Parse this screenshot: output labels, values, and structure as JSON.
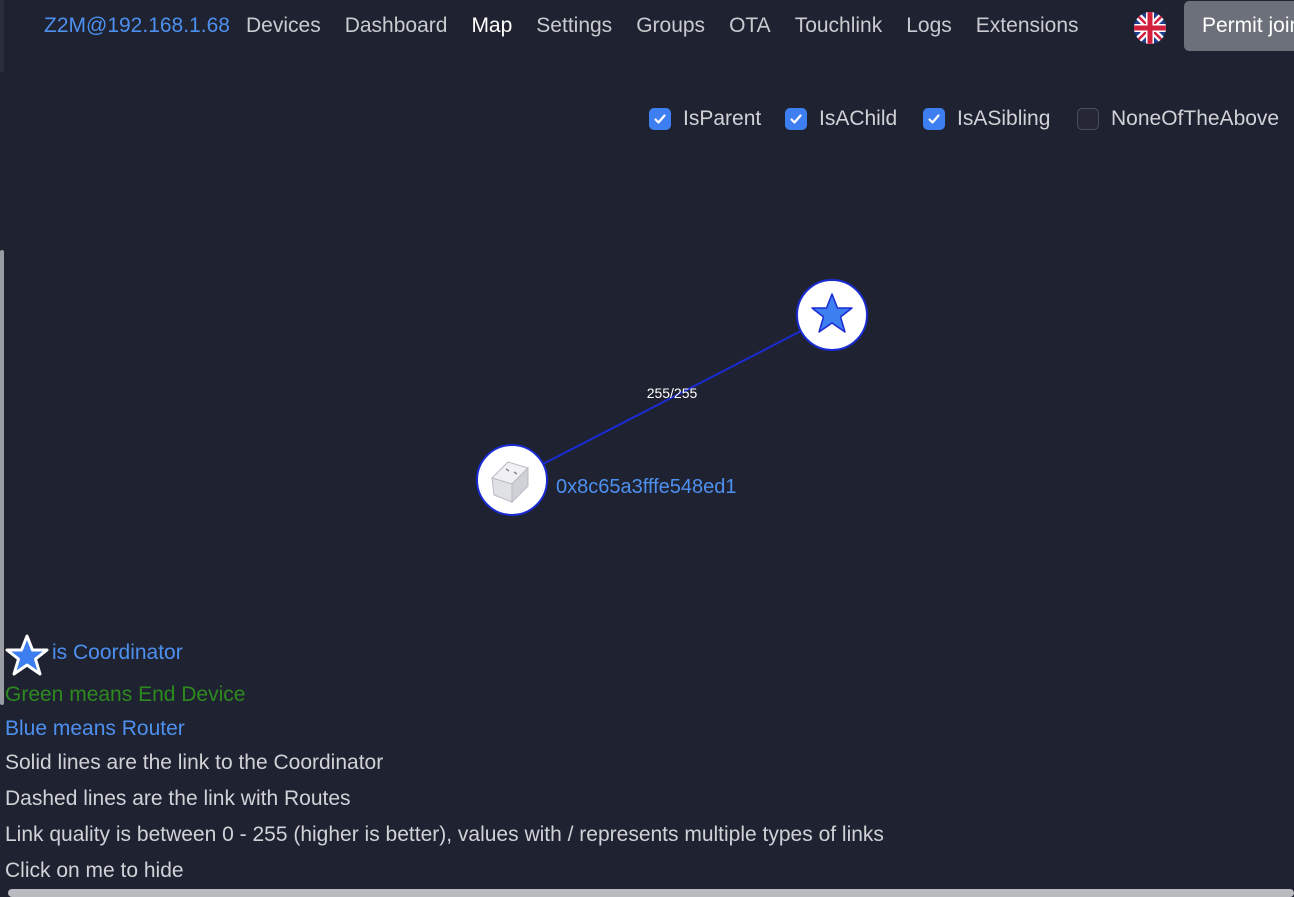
{
  "navbar": {
    "brand": "Z2M@192.168.1.68",
    "links": [
      {
        "label": "Devices",
        "active": false
      },
      {
        "label": "Dashboard",
        "active": false
      },
      {
        "label": "Map",
        "active": true
      },
      {
        "label": "Settings",
        "active": false
      },
      {
        "label": "Groups",
        "active": false
      },
      {
        "label": "OTA",
        "active": false
      },
      {
        "label": "Touchlink",
        "active": false
      },
      {
        "label": "Logs",
        "active": false
      },
      {
        "label": "Extensions",
        "active": false
      }
    ],
    "language_icon": "uk-flag-icon",
    "permit_join_label": "Permit join"
  },
  "filters": [
    {
      "label": "IsParent",
      "checked": true
    },
    {
      "label": "IsAChild",
      "checked": true
    },
    {
      "label": "IsASibling",
      "checked": true
    },
    {
      "label": "NoneOfTheAbove",
      "checked": false
    }
  ],
  "map": {
    "coordinator_icon": "star-icon",
    "device_icon": "smart-plug-icon",
    "device_label": "0x8c65a3fffe548ed1",
    "link_label": "255/255",
    "colors": {
      "link": "#1a2bd1",
      "node_fill": "#ffffff",
      "coordinator_star": "#3d7ef0",
      "device_label": "#4d90f0"
    }
  },
  "legend": {
    "coordinator": "is Coordinator",
    "end_device": "Green means End Device",
    "router": "Blue means Router",
    "solid": "Solid lines are the link to the Coordinator",
    "dashed": "Dashed lines are the link with Routes",
    "quality": "Link quality is between 0 - 255 (higher is better), values with / represents multiple types of links",
    "hide": "Click on me to hide"
  }
}
